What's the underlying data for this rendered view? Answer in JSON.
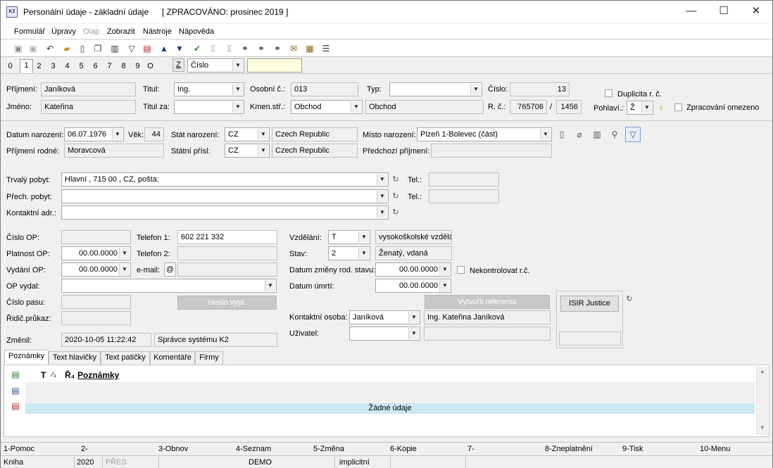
{
  "window": {
    "app_icon": "K2",
    "title": "Personální údaje - základní údaje",
    "status_title": "[ ZPRACOVÁNO: prosinec 2019 ]",
    "minimize": "—",
    "maximize": "☐",
    "close": "✕"
  },
  "menu": [
    "Formulář",
    "Úpravy",
    "Olap",
    "Zobrazit",
    "Nástroje",
    "Nápověda"
  ],
  "toolbar_icons": [
    "save-icon",
    "save-as-icon",
    "undo-icon",
    "open-folder-icon",
    "new-document-icon",
    "copy-icon",
    "book-icon",
    "filter-icon",
    "filter-document-icon",
    "arrow-up-icon",
    "arrow-down-icon",
    "check-plant-icon",
    "sum-icon",
    "sum-gray-icon",
    "binoculars-icon",
    "binoculars-next-icon",
    "binoculars-all-icon",
    "mail-icon",
    "notepad-icon",
    "hamburger-menu-icon"
  ],
  "page_tabs": [
    "0",
    "1",
    "2",
    "3",
    "4",
    "5",
    "6",
    "7",
    "8",
    "9",
    "O"
  ],
  "sort": {
    "key": "Z",
    "field": "Číslo",
    "search": ""
  },
  "person": {
    "surname_label": "Příjmení:",
    "surname": "Janíková",
    "name_label": "Jméno:",
    "name": "Kateřina",
    "title_label": "Titul:",
    "title": "Ing.",
    "title_after_label": "Titul za:",
    "title_after": "",
    "personal_no_label": "Osobní č.:",
    "personal_no": "013",
    "home_centre_label": "Kmen.stř.:",
    "home_centre": "Obchod",
    "home_centre_name": "Obchod",
    "type_label": "Typ:",
    "type": "",
    "number_label": "Číslo:",
    "number": "13",
    "birth_no_label": "R. č.:",
    "birth_no_1": "765706",
    "birth_no_sep": "/",
    "birth_no_2": "1456",
    "duplicity_label": "Duplicita r. č.",
    "gender_label": "Pohlaví.:",
    "gender": "Ž",
    "restricted_label": "Zpracování omezeno"
  },
  "birth": {
    "date_label": "Datum narození:",
    "date": "06.07.1976",
    "age_label": "Věk:",
    "age": "44",
    "country_label": "Stát narození:",
    "country_code": "CZ",
    "country_name": "Czech Republic",
    "place_label": "Místo narození:",
    "place": "Plzeň 1-Bolevec (část)",
    "maiden_label": "Příjmení rodné:",
    "maiden": "Moravcová",
    "citizenship_label": "Státní přísl:",
    "citizenship_code": "CZ",
    "citizenship_name": "Czech Republic",
    "prev_surname_label": "Předchozí příjmení:",
    "prev_surname": ""
  },
  "address": {
    "permanent_label": "Trvalý pobyt:",
    "permanent": "Hlavní , 715 00  , CZ, pošta:",
    "temporary_label": "Přech. pobyt:",
    "temporary": "",
    "contact_label": "Kontaktní adr.:",
    "contact": "",
    "tel_label": "Tel.:",
    "tel1": "",
    "tel2": ""
  },
  "docs": {
    "op_no_label": "Číslo OP:",
    "op_no": "",
    "op_valid_label": "Platnost OP:",
    "op_valid": "00.00.0000",
    "op_issued_label": "Vydání OP:",
    "op_issued": "00.00.0000",
    "op_issuer_label": "OP vydal:",
    "op_issuer": "",
    "passport_label": "Číslo pasu:",
    "passport": "",
    "driver_label": "Řidič.průkaz:",
    "driver": "",
    "changed_label": "Změnil:",
    "changed_date": "2020-10-05 11:22:42",
    "changed_by": "Správce systému K2"
  },
  "contact": {
    "phone1_label": "Telefon 1:",
    "phone1": "602 221 332",
    "phone2_label": "Telefon 2:",
    "phone2": "",
    "email_label": "e-mail:",
    "email_btn": "@",
    "email": "",
    "password_btn": "Heslo vypl."
  },
  "education": {
    "edu_label": "Vzdělání:",
    "edu_code": "T",
    "edu_name": "vysokoškolské vzdělán",
    "state_label": "Stav:",
    "state_code": "2",
    "state_name": "Ženatý, vdaná",
    "state_change_label": "Datum změny rod. stavu:",
    "state_change": "00.00.0000",
    "uncheck_label": "Nekontrolovat r.č.",
    "death_label": "Datum úmrtí:",
    "death": "00.00.0000",
    "create_ref_btn": "Vytvořit referenta",
    "contact_person_label": "Kontaktní osoba:",
    "contact_person": "Janíková",
    "contact_person_full": "Ing. Kateřina Janíková",
    "user_label": "Uživatel:",
    "user": "",
    "user_name": ""
  },
  "isir": {
    "button": "ISIR Justice",
    "value": ""
  },
  "bottom_tabs": [
    "Poznámky",
    "Text hlavičky",
    "Text patičky",
    "Komentáře",
    "Firmy"
  ],
  "notes": {
    "col_t": "T",
    "col_f": "⁄₃",
    "col_r": "Ř₄",
    "col_notes": "Poznámky",
    "empty": "Žádné údaje"
  },
  "fkeys": [
    "1-Pomoc",
    "2-",
    "3-Obnov",
    "4-Seznam",
    "5-Změna",
    "6-Kopie",
    "7-",
    "8-Zneplatnění",
    "9-Tisk",
    "10-Menu"
  ],
  "status": {
    "book": "Kniha",
    "year": "2020",
    "pres": "PŘES",
    "db": "DEMO",
    "mode": "implicitní"
  }
}
